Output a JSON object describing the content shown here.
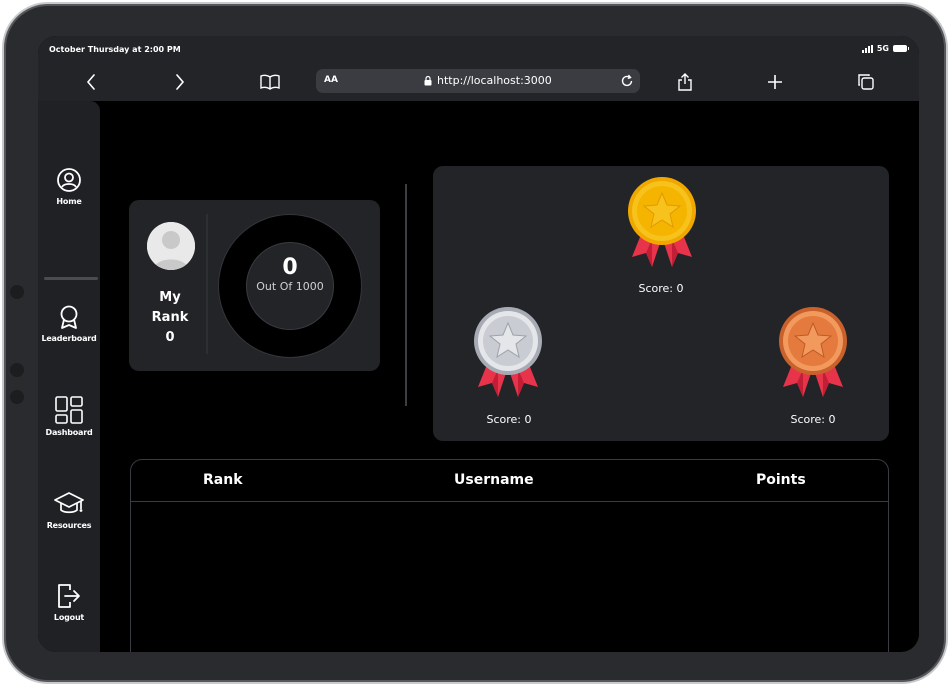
{
  "status": {
    "time": "October Thursday at 2:00 PM",
    "network": "5G"
  },
  "browser": {
    "text_size": "AA",
    "url": "http://localhost:3000"
  },
  "sidebar": {
    "items": [
      {
        "label": "Home",
        "icon": "user-circle-icon"
      },
      {
        "label": "Leaderboard",
        "icon": "award-icon"
      },
      {
        "label": "Dashboard",
        "icon": "dashboard-grid-icon"
      },
      {
        "label": "Resources",
        "icon": "graduation-cap-icon"
      },
      {
        "label": "Logout",
        "icon": "logout-icon"
      }
    ]
  },
  "rank_card": {
    "title_line1": "My",
    "title_line2": "Rank",
    "rank": "0",
    "score": "0",
    "score_sub": "Out Of 1000"
  },
  "podium": {
    "gold": {
      "score": "Score: 0",
      "color": "#f5b800"
    },
    "silver": {
      "score": "Score: 0",
      "color": "#c9ccd2"
    },
    "bronze": {
      "score": "Score: 0",
      "color": "#e47a3e"
    }
  },
  "table": {
    "headers": [
      "Rank",
      "Username",
      "Points"
    ],
    "rows": []
  },
  "colors": {
    "accent_ribbon": "#e8344a",
    "card": "#222428",
    "background": "#000000"
  }
}
